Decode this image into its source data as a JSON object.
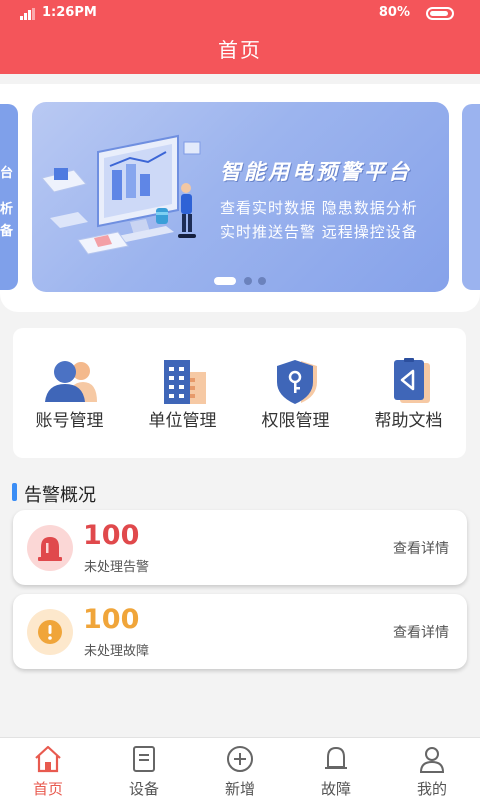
{
  "status_bar": {
    "time": "1:26PM",
    "battery": "80%"
  },
  "header": {
    "title": "首页"
  },
  "banner": {
    "title": "智能用电预警平台",
    "line1": "查看实时数据  隐患数据分析",
    "line2": "实时推送告警  远程操控设备",
    "peek_left_chars": [
      "台",
      "析",
      "备"
    ],
    "slide_count": 3,
    "active_slide": 1
  },
  "menu": {
    "items": [
      {
        "label": "账号管理",
        "icon": "users-icon"
      },
      {
        "label": "单位管理",
        "icon": "building-icon"
      },
      {
        "label": "权限管理",
        "icon": "shield-key-icon"
      },
      {
        "label": "帮助文档",
        "icon": "help-doc-icon"
      }
    ]
  },
  "overview": {
    "title": "告警概况",
    "cards": [
      {
        "count": "100",
        "label": "未处理告警",
        "link": "查看详情",
        "icon": "alarm-icon",
        "color": "#e0494c",
        "circle": "#fbd7d6"
      },
      {
        "count": "100",
        "label": "未处理故障",
        "link": "查看详情",
        "icon": "warning-icon",
        "color": "#f0a53a",
        "circle": "#fde8cc"
      }
    ]
  },
  "tabs": [
    {
      "label": "首页",
      "icon": "home-icon",
      "active": true
    },
    {
      "label": "设备",
      "icon": "device-icon",
      "active": false
    },
    {
      "label": "新增",
      "icon": "add-icon",
      "active": false
    },
    {
      "label": "故障",
      "icon": "bell-icon",
      "active": false
    },
    {
      "label": "我的",
      "icon": "user-icon",
      "active": false
    }
  ],
  "colors": {
    "primary": "#f4555a",
    "accent_blue": "#3a8df5",
    "tab_active": "#e85a4f"
  }
}
